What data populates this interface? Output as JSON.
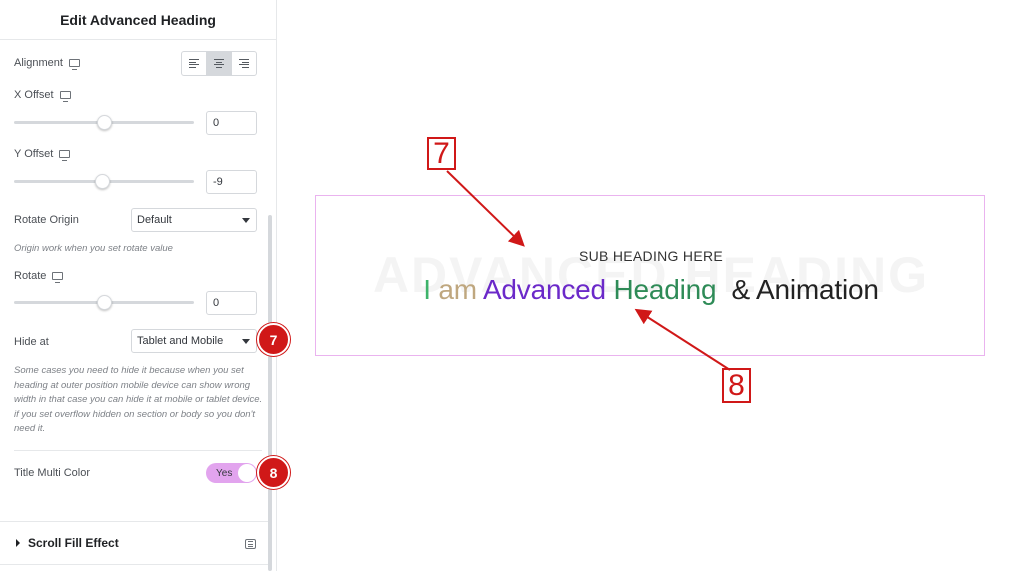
{
  "panel": {
    "title": "Edit Advanced Heading",
    "alignment_label": "Alignment",
    "alignment_options": [
      "left",
      "center",
      "right"
    ],
    "alignment_selected": "center",
    "x_offset": {
      "label": "X Offset",
      "value": "0",
      "slider_fraction": 0.5
    },
    "y_offset": {
      "label": "Y Offset",
      "value": "-9",
      "slider_fraction": 0.49
    },
    "rotate_origin": {
      "label": "Rotate Origin",
      "value": "Default",
      "note": "Origin work when you set rotate value"
    },
    "rotate": {
      "label": "Rotate",
      "value": "0",
      "slider_fraction": 0.5
    },
    "hide_at": {
      "label": "Hide at",
      "value": "Tablet and Mobile",
      "note": "Some cases you need to hide it because when you set heading at outer position mobile device can show wrong width in that case you can hide it at mobile or tablet device. if you set overflow hidden on section or body so you don't need it."
    },
    "title_multi_color": {
      "label": "Title Multi Color",
      "toggle_text": "Yes",
      "enabled": true
    },
    "scroll_fill_section": "Scroll Fill Effect"
  },
  "badges": {
    "hide_at": "7",
    "multi_color": "8"
  },
  "preview": {
    "watermark": "ADVANCED HEADING",
    "subheading": "SUB HEADING HERE",
    "heading_parts": [
      {
        "text": "I",
        "color": "#3db36a"
      },
      {
        "text": " am ",
        "color": "#bfa77f"
      },
      {
        "text": "Advanced",
        "color": "#6b29c9"
      },
      {
        "text": " Heading",
        "color": "#2e8b57"
      },
      {
        "text": "  & Animation",
        "color": "#222222"
      }
    ]
  },
  "callouts": {
    "top": "7",
    "bottom": "8"
  },
  "colors": {
    "badge_red": "#d01818",
    "toggle_pink": "#e2a4ee",
    "preview_border": "#eab3ef"
  },
  "icons": [
    "desktop-icon",
    "align-left-icon",
    "align-center-icon",
    "align-right-icon",
    "caret-down-icon",
    "caret-right-icon",
    "list-icon"
  ]
}
